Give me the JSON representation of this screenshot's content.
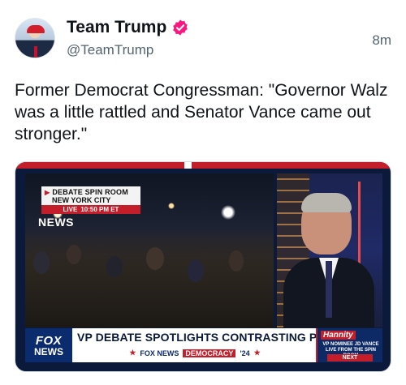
{
  "header": {
    "display_name": "Team Trump",
    "handle": "@TeamTrump",
    "time_ago": "8m"
  },
  "tweet": {
    "text": "Former Democrat Congressman: \"Governor Walz was a little rattled and Senator Vance came out stronger.\""
  },
  "video": {
    "spin_room_line1": "DEBATE SPIN ROOM",
    "spin_room_line2": "NEW YORK CITY",
    "live_label": "LIVE",
    "live_time": "10:50 PM ET",
    "news_bug": "NEWS",
    "fox_logo_line1": "FOX",
    "fox_logo_line2": "NEWS",
    "headline": "VP DEBATE SPOTLIGHTS CONTRASTING POLICIES",
    "sub_brand": "FOX NEWS",
    "sub_democracy": "DEMOCRACY",
    "sub_year": "'24",
    "hannity_logo": "Hannity",
    "hannity_promo": "VP NOMINEE JD VANCE LIVE FROM THE SPIN ROOM",
    "hannity_next": "NEXT"
  },
  "colors": {
    "verified_badge": "#f91880",
    "fox_red": "#c41e2a",
    "fox_blue": "#0a2b6e"
  },
  "icons": {
    "verified": "verified-badge-icon",
    "star": "star-icon"
  }
}
